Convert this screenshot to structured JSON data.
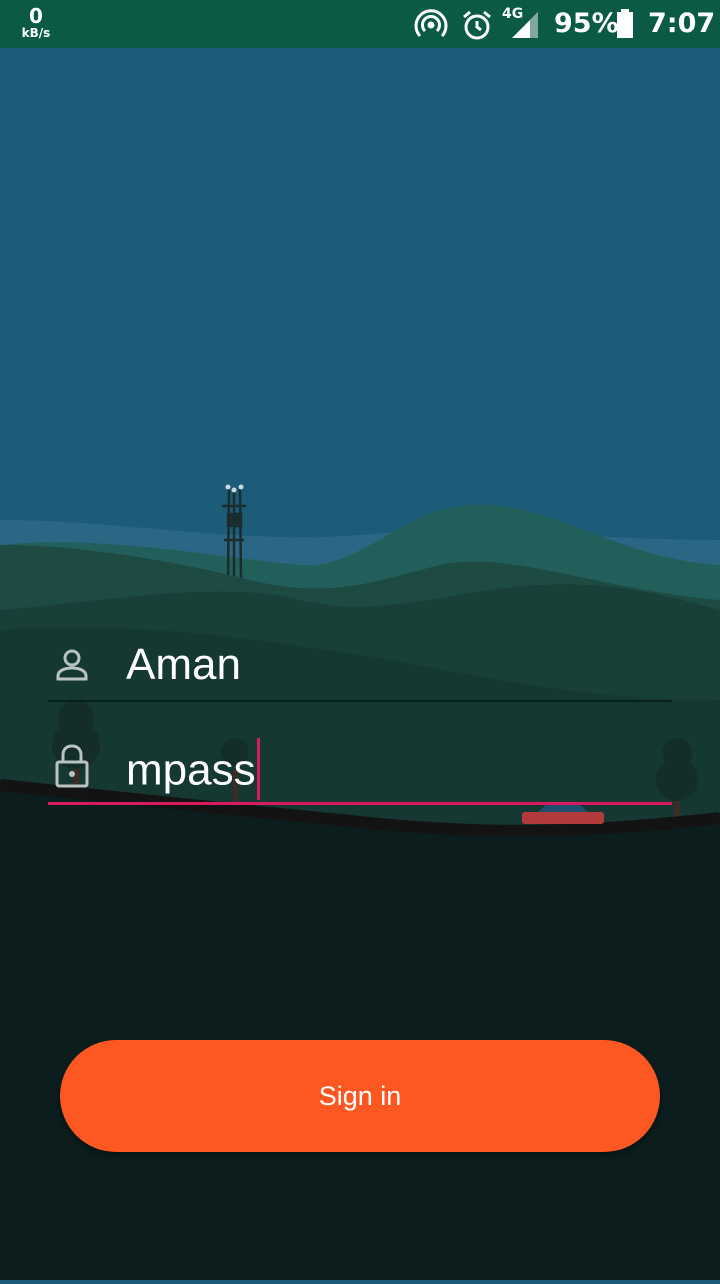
{
  "status_bar": {
    "net_speed_value": "0",
    "net_speed_unit": "kB/s",
    "network_type": "4G",
    "battery_percent": "95%",
    "time": "7:07",
    "icons": [
      "hotspot-icon",
      "alarm-icon",
      "signal-icon",
      "battery-icon"
    ]
  },
  "login": {
    "username": {
      "value": "Aman",
      "icon": "person-icon"
    },
    "password": {
      "value": "mpass",
      "icon": "lock-icon"
    },
    "sign_in_label": "Sign in"
  },
  "colors": {
    "status_bar": "#0a5a46",
    "sky": "#1c5c78",
    "accent": "#d81b60",
    "button": "#ff5722",
    "ground": "#0b1d1d"
  }
}
